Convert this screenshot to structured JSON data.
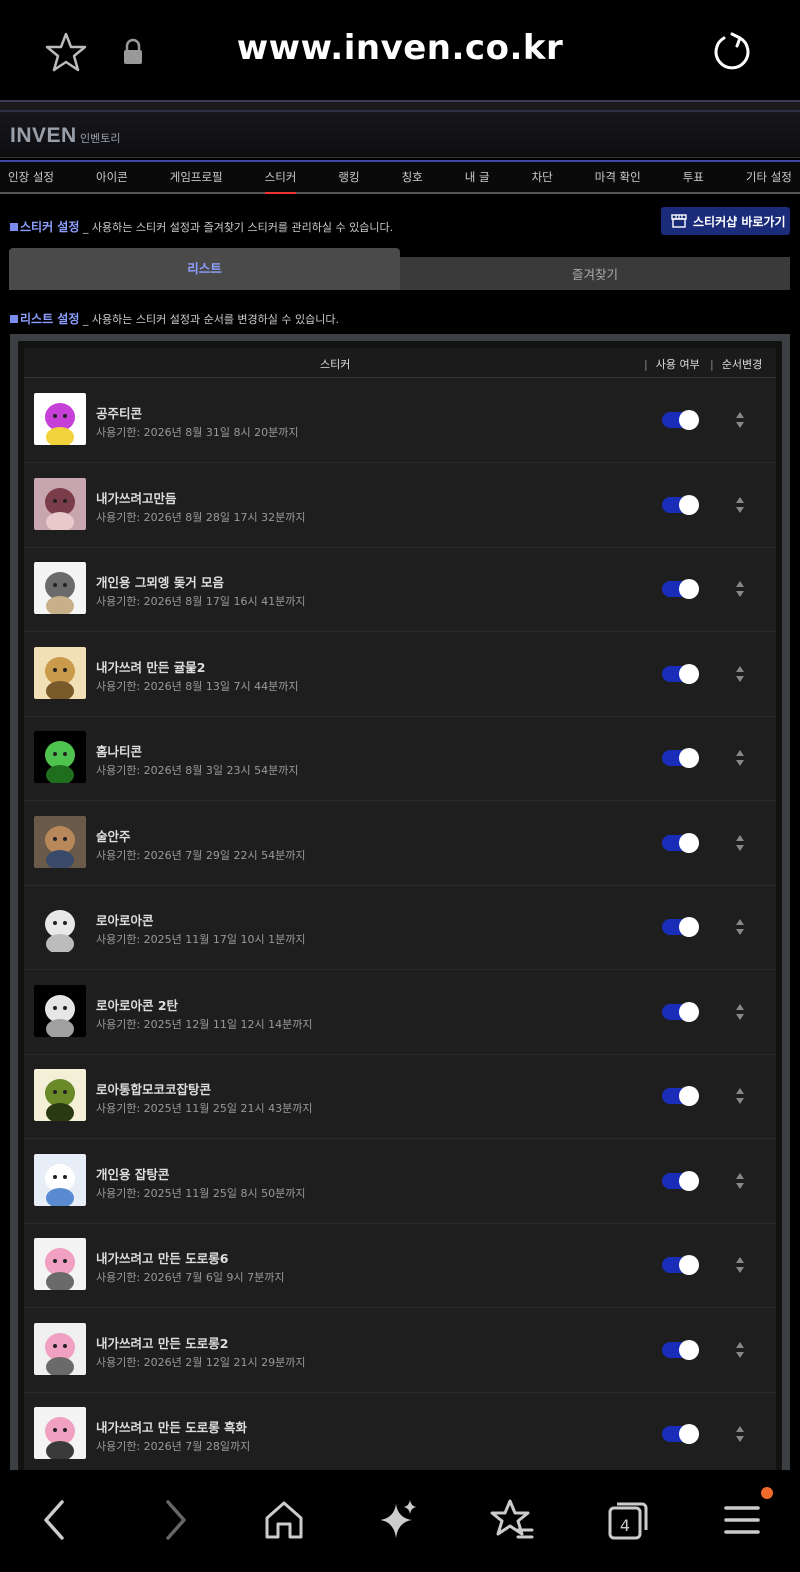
{
  "browser": {
    "url": "www.inven.co.kr",
    "tab_count": "4",
    "icons": [
      "star-icon",
      "lock-icon",
      "reload-icon",
      "back-icon",
      "forward-icon",
      "home-icon",
      "sparkle-icon",
      "bookmarks-icon",
      "tabs-icon",
      "menu-icon"
    ],
    "notification_color": "#f06a2a"
  },
  "site": {
    "logo": "INVEN",
    "logo_sub": "인벤토리"
  },
  "nav": {
    "items": [
      "인장 설정",
      "아이콘",
      "게임프로필",
      "스티커",
      "랭킹",
      "칭호",
      "내 글",
      "차단",
      "마격 확인",
      "투표",
      "기타 설정"
    ],
    "active": "스티커"
  },
  "sticker_settings": {
    "title": "스티커 설정",
    "desc": "_ 사용하는 스티커 설정과 즐겨찾기 스티커를 관리하실 수 있습니다.",
    "shop_button": "스티커샵 바로가기"
  },
  "tabs": {
    "list": "리스트",
    "favorites": "즐겨찾기"
  },
  "list_settings": {
    "title": "리스트 설정",
    "desc": "_ 사용하는 스티커 설정과 순서를 변경하실 수 있습니다."
  },
  "table": {
    "headers": {
      "sticker": "스티커",
      "use": "사용 여부",
      "order": "순서변경"
    },
    "rows": [
      {
        "name": "공주티콘",
        "expire": "사용기한: 2026년 8월 31일 8시 20분까지",
        "enabled": true
      },
      {
        "name": "내가쓰려고만듬",
        "expire": "사용기한: 2026년 8월 28일 17시 32분까지",
        "enabled": true
      },
      {
        "name": "개인용 그뫼엥 돚거 모음",
        "expire": "사용기한: 2026년 8월 17일 16시 41분까지",
        "enabled": true
      },
      {
        "name": "내가쓰려 만든 귤뭁2",
        "expire": "사용기한: 2026년 8월 13일 7시 44분까지",
        "enabled": true
      },
      {
        "name": "홈나티콘",
        "expire": "사용기한: 2026년 8월 3일 23시 54분까지",
        "enabled": true
      },
      {
        "name": "술안주",
        "expire": "사용기한: 2026년 7월 29일 22시 54분까지",
        "enabled": true
      },
      {
        "name": "로아로아콘",
        "expire": "사용기한: 2025년 11월 17일 10시 1분까지",
        "enabled": true
      },
      {
        "name": "로아로아콘 2탄",
        "expire": "사용기한: 2025년 12월 11일 12시 14분까지",
        "enabled": true
      },
      {
        "name": "로아통합모코코잡탕콘",
        "expire": "사용기한: 2025년 11월 25일 21시 43분까지",
        "enabled": true
      },
      {
        "name": "개인용 잡탕콘",
        "expire": "사용기한: 2025년 11월 25일 8시 50분까지",
        "enabled": true
      },
      {
        "name": "내가쓰려고 만든 도로롱6",
        "expire": "사용기한: 2026년 7월 6일 9시 7분까지",
        "enabled": true
      },
      {
        "name": "내가쓰려고 만든 도로롱2",
        "expire": "사용기한: 2026년 2월 12일 21시 29분까지",
        "enabled": true
      },
      {
        "name": "내가쓰려고 만든 도로롱 흑화",
        "expire": "사용기한: 2026년 7월 28일까지",
        "enabled": true
      }
    ]
  }
}
